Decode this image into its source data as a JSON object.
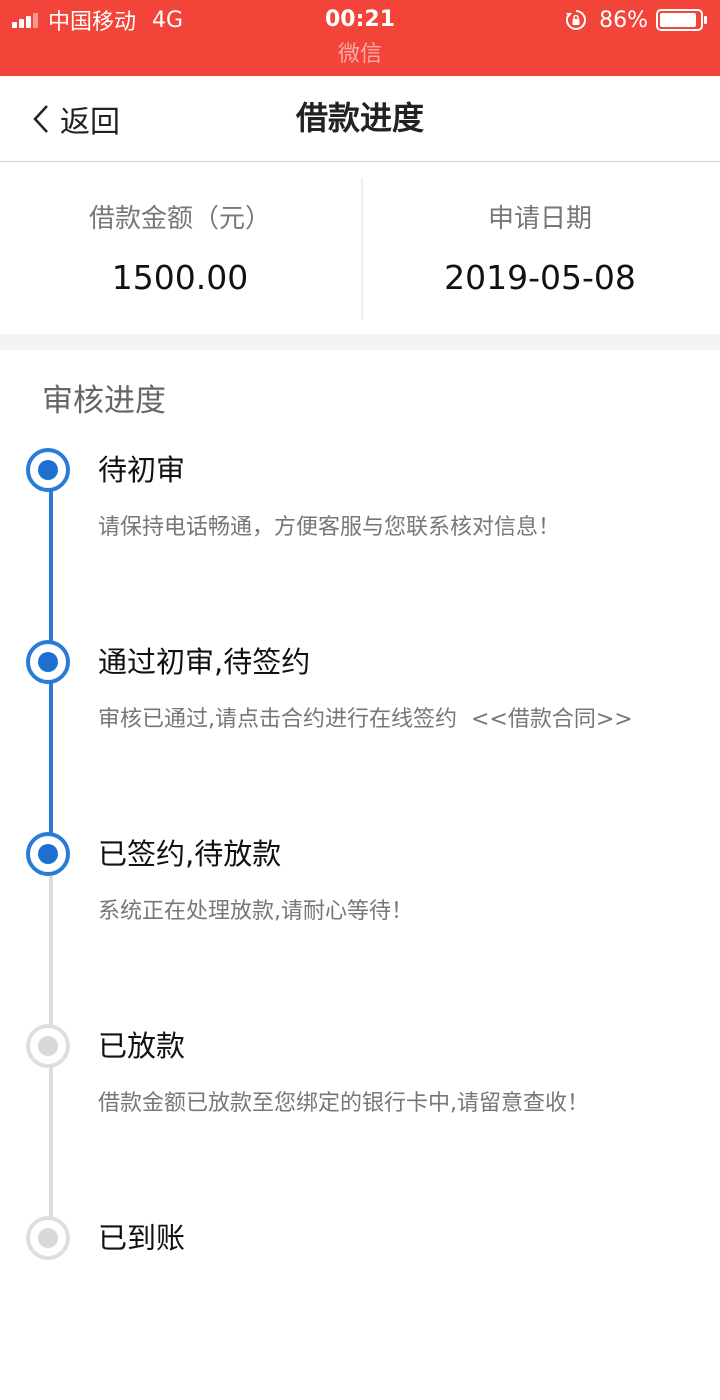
{
  "status_bar": {
    "carrier": "中国移动",
    "network": "4G",
    "time": "00:21",
    "app_name": "微信",
    "battery": "86%",
    "bar_color": "#f24438",
    "signal_level": 3
  },
  "nav": {
    "back_label": "返回",
    "title": "借款进度"
  },
  "summary": {
    "amount_label": "借款金额（元）",
    "amount_value": "1500.00",
    "date_label": "申请日期",
    "date_value": "2019-05-08"
  },
  "progress": {
    "title": "审核进度",
    "active_color": "#2a7ad6",
    "inactive_color": "#dcdcdc",
    "completed_steps": 3,
    "steps": [
      {
        "title": "待初审",
        "desc": "请保持电话畅通，方便客服与您联系核对信息！"
      },
      {
        "title": "通过初审,待签约",
        "desc": "审核已通过,请点击合约进行在线签约",
        "link": "<<借款合同>>"
      },
      {
        "title": "已签约,待放款",
        "desc": "系统正在处理放款,请耐心等待！"
      },
      {
        "title": "已放款",
        "desc": "借款金额已放款至您绑定的银行卡中,请留意查收！"
      },
      {
        "title": "已到账",
        "desc": ""
      }
    ]
  }
}
